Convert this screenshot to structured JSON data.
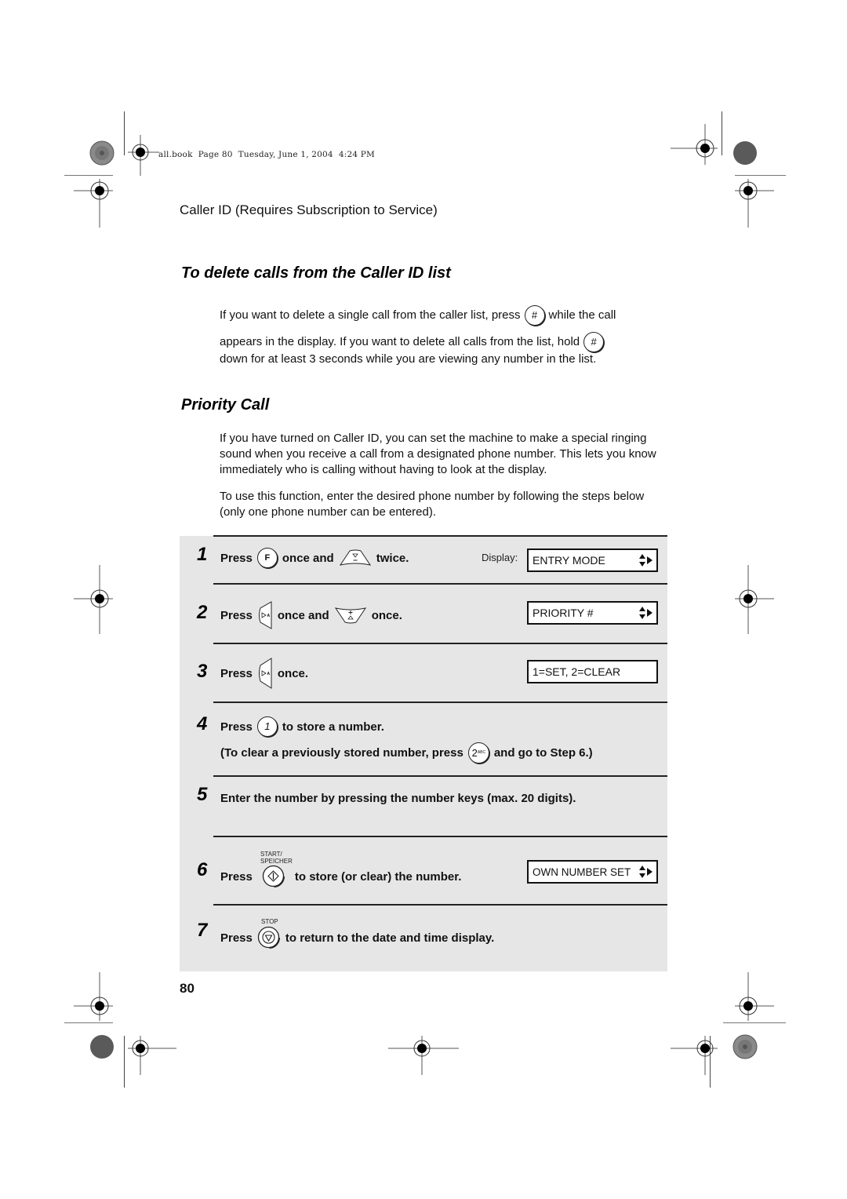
{
  "header_slug": "all.book  Page 80  Tuesday, June 1, 2004  4:24 PM",
  "running_head": "Caller ID (Requires Subscription to Service)",
  "section_delete": {
    "title": "To delete calls from the Caller ID list",
    "line1_a": "If you want to delete a single call from the caller list, press",
    "line1_b": "while the call",
    "line2_a": "appears in the display. If you want to delete all calls from the list, hold",
    "line3": "down for at least 3 seconds while you are viewing any number in the list.",
    "key_hash": "#"
  },
  "section_priority": {
    "title": "Priority Call",
    "para1": "If you have turned on Caller ID, you can set the machine to make a special ringing sound when you receive a call from a designated phone number. This lets you know immediately who is calling without having to look at the display.",
    "para2": "To use this function, enter the desired phone number by following the steps below (only one phone number can be entered)."
  },
  "display_label": "Display:",
  "steps": [
    {
      "num": "1",
      "press": "Press",
      "mid": "once and",
      "end": "twice.",
      "key1": "F",
      "key2_icon": "down-arrow-key-icon",
      "display": "ENTRY MODE"
    },
    {
      "num": "2",
      "press": "Press",
      "mid": "once and",
      "end": "once.",
      "key1_icon": "right-arrow-key-icon",
      "key2_icon": "up-arrow-key-icon",
      "display": "PRIORITY #"
    },
    {
      "num": "3",
      "press": "Press",
      "end": "once.",
      "key1_icon": "right-arrow-key-icon",
      "display": "1=SET, 2=CLEAR"
    },
    {
      "num": "4",
      "press": "Press",
      "key": "1",
      "end": "to store a number.",
      "sub_a": "(To clear a previously stored number, press",
      "sub_key": "2",
      "sub_key_small": "ABC",
      "sub_b": "and go to Step 6.)"
    },
    {
      "num": "5",
      "text": "Enter the number by pressing the number keys (max. 20 digits)."
    },
    {
      "num": "6",
      "press": "Press",
      "key_label_1": "START/",
      "key_label_2": "SPEICHER",
      "end": "to store (or clear) the number.",
      "display": "OWN NUMBER SET"
    },
    {
      "num": "7",
      "press": "Press",
      "key_label": "STOP",
      "end": "to return to the date and time display."
    }
  ],
  "page_number": "80"
}
